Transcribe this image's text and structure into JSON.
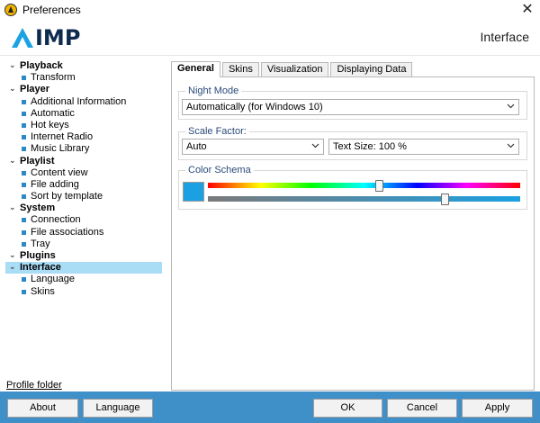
{
  "window": {
    "title": "Preferences",
    "close_glyph": "✕"
  },
  "header": {
    "logo_text": "IMP",
    "page_title": "Interface"
  },
  "sidebar": {
    "tree": [
      {
        "label": "Playback",
        "level": 0
      },
      {
        "label": "Transform",
        "level": 1
      },
      {
        "label": "Player",
        "level": 0
      },
      {
        "label": "Additional Information",
        "level": 1
      },
      {
        "label": "Automatic",
        "level": 1
      },
      {
        "label": "Hot keys",
        "level": 1
      },
      {
        "label": "Internet Radio",
        "level": 1
      },
      {
        "label": "Music Library",
        "level": 1
      },
      {
        "label": "Playlist",
        "level": 0
      },
      {
        "label": "Content view",
        "level": 1
      },
      {
        "label": "File adding",
        "level": 1
      },
      {
        "label": "Sort by template",
        "level": 1
      },
      {
        "label": "System",
        "level": 0
      },
      {
        "label": "Connection",
        "level": 1
      },
      {
        "label": "File associations",
        "level": 1
      },
      {
        "label": "Tray",
        "level": 1
      },
      {
        "label": "Plugins",
        "level": 0
      },
      {
        "label": "Interface",
        "level": 0,
        "selected": true
      },
      {
        "label": "Language",
        "level": 1
      },
      {
        "label": "Skins",
        "level": 1
      }
    ],
    "profile_link": "Profile folder"
  },
  "tabs": [
    {
      "label": "General",
      "active": true
    },
    {
      "label": "Skins"
    },
    {
      "label": "Visualization"
    },
    {
      "label": "Displaying Data"
    }
  ],
  "night_mode": {
    "label": "Night Mode",
    "value": "Automatically (for Windows 10)"
  },
  "scale_factor": {
    "label": "Scale Factor:",
    "value": "Auto",
    "text_size": "Text Size: 100 %"
  },
  "color_schema": {
    "label": "Color Schema",
    "swatch_color": "#1ba0e2",
    "hue_fraction": 0.55,
    "saturation_fraction": 0.76
  },
  "footer": {
    "about": "About",
    "language": "Language",
    "ok": "OK",
    "cancel": "Cancel",
    "apply": "Apply",
    "background": "#3f8fc9"
  },
  "icons": {
    "app": "aimp-app-icon",
    "close": "close-icon",
    "expand": "chevron-down-icon",
    "bullet": "bullet-icon",
    "dropdown": "chevron-down-icon"
  }
}
